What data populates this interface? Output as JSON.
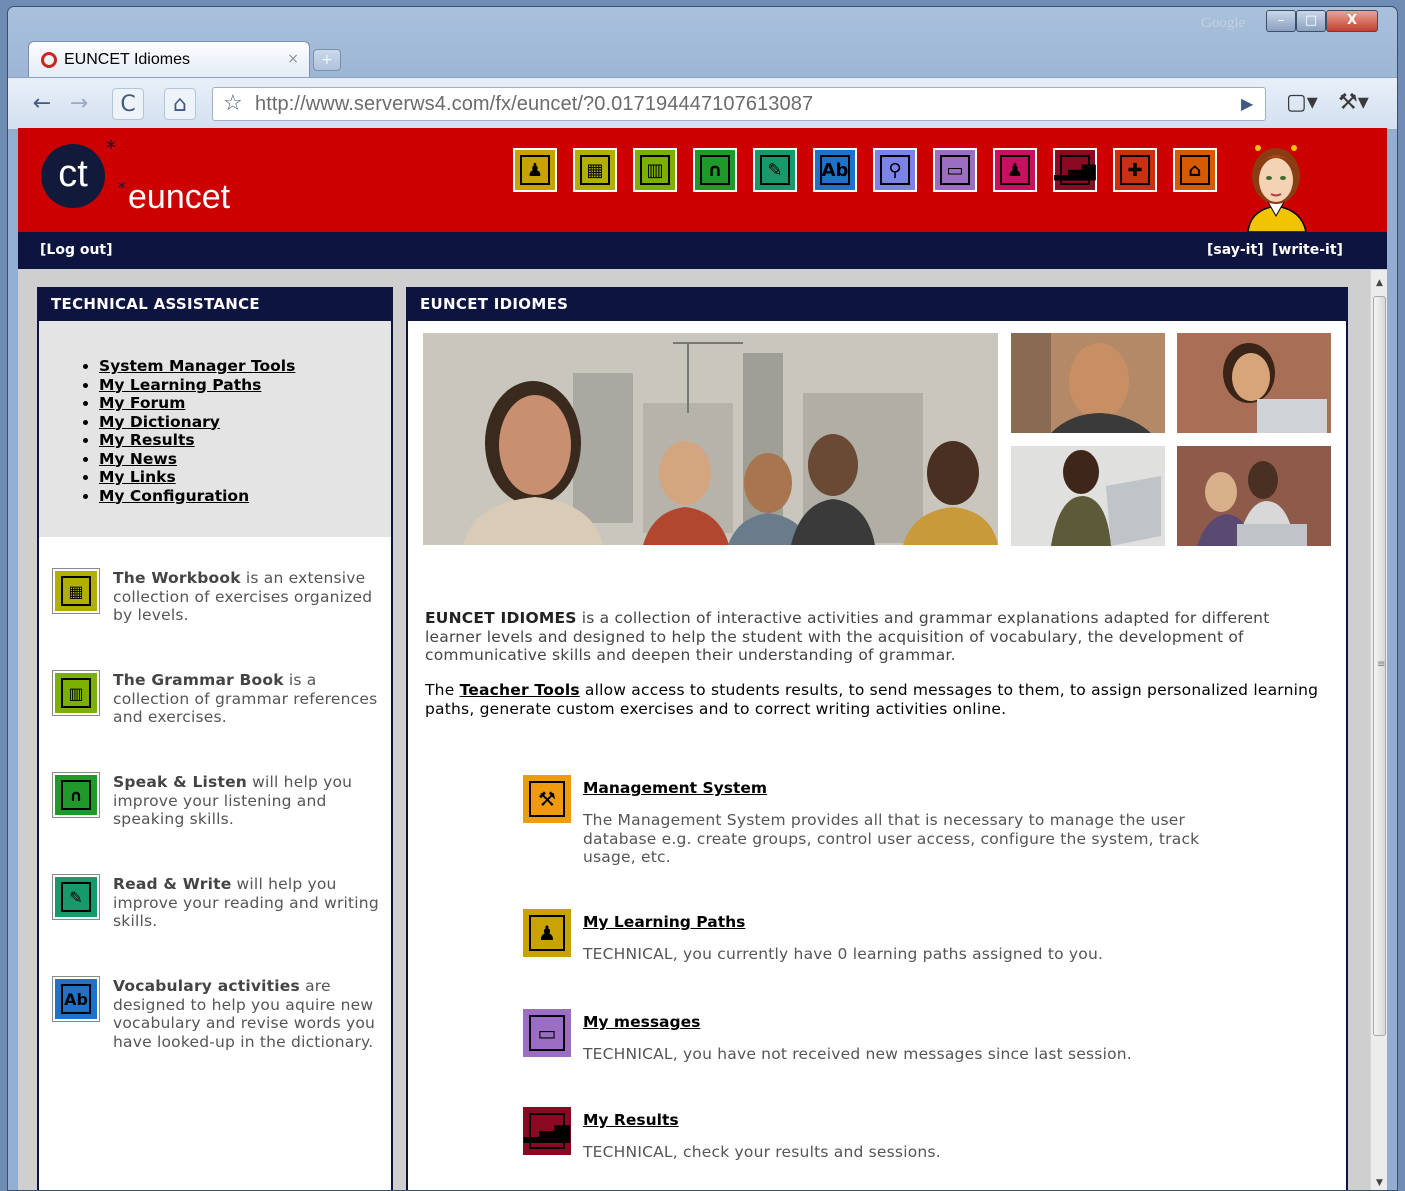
{
  "browser": {
    "tab_title": "EUNCET Idiomes",
    "tab_close": "×",
    "new_tab": "+",
    "search_brand": "Google",
    "url": "http://www.serverws4.com/fx/euncet/?0.017194447107613087",
    "window_controls": {
      "minimize": "–",
      "maximize": "□",
      "close": "X"
    }
  },
  "header": {
    "logo_initials": "ct",
    "logo_word": "euncet",
    "nav_icons": [
      {
        "name": "teacher-icon",
        "glyph": "♟",
        "bg": "#c8a200"
      },
      {
        "name": "workbook-icon",
        "glyph": "▦",
        "bg": "#b1b000"
      },
      {
        "name": "grammar-book-icon",
        "glyph": "▥",
        "bg": "#7bb000"
      },
      {
        "name": "speak-listen-icon",
        "glyph": "∩",
        "bg": "#1f9a2a"
      },
      {
        "name": "read-write-icon",
        "glyph": "✎",
        "bg": "#169a6a"
      },
      {
        "name": "vocabulary-icon",
        "glyph": "Ab",
        "bg": "#1e73c8"
      },
      {
        "name": "dictionary-search-icon",
        "glyph": "⚲",
        "bg": "#7c83e8"
      },
      {
        "name": "messages-icon",
        "glyph": "▭",
        "bg": "#9c6ec3"
      },
      {
        "name": "forum-users-icon",
        "glyph": "♟",
        "bg": "#c81060"
      },
      {
        "name": "results-icon",
        "glyph": "▂▄▆",
        "bg": "#8a0a24"
      },
      {
        "name": "first-aid-icon",
        "glyph": "✚",
        "bg": "#c83010"
      },
      {
        "name": "home-icon",
        "glyph": "⌂",
        "bg": "#d85a00"
      }
    ]
  },
  "topbar": {
    "logout": "[Log out]",
    "sayit": "[say-it]",
    "writeit": "[write-it]"
  },
  "left": {
    "title": "TECHNICAL ASSISTANCE",
    "menu": [
      "System Manager Tools",
      "My Learning Paths",
      "My Forum",
      "My Dictionary",
      "My Results",
      "My News",
      "My Links",
      "My Configuration"
    ],
    "features": [
      {
        "bold": "The Workbook",
        "rest": " is an extensive collection of exercises organized by levels.",
        "glyph": "▦",
        "bg": "#b1b000"
      },
      {
        "bold": "The Grammar Book",
        "rest": " is a collection of grammar references and exercises.",
        "glyph": "▥",
        "bg": "#7bb000"
      },
      {
        "bold": "Speak & Listen",
        "rest": " will help you improve your listening and speaking skills.",
        "glyph": "∩",
        "bg": "#1f9a2a"
      },
      {
        "bold": "Read & Write",
        "rest": " will help you improve your reading and writing skills.",
        "glyph": "✎",
        "bg": "#169a6a"
      },
      {
        "bold": "Vocabulary activities",
        "rest": " are designed to help you aquire new vocabulary and revise words you have looked-up in the dictionary.",
        "glyph": "Ab",
        "bg": "#1e73c8"
      }
    ]
  },
  "main": {
    "title": "EUNCET IDIOMES",
    "intro_bold": "EUNCET IDIOMES",
    "intro_rest": " is a collection of interactive activities and grammar explanations adapted for different learner levels and designed to help the student with the acquisition of vocabulary, the development of communicative skills and deepen their understanding of grammar.",
    "teacher_pre": "The ",
    "teacher_link": "Teacher Tools",
    "teacher_post": " allow access to students results, to send messages to them, to assign personalized learning paths, generate custom exercises and to correct writing activities online.",
    "services": [
      {
        "title": "Management System",
        "desc": "The Management System provides all that is necessary to manage the user database e.g. create groups, control user access, configure the system, track usage, etc.",
        "glyph": "⚒",
        "bg": "#f09a10"
      },
      {
        "title": "My Learning Paths",
        "desc": "TECHNICAL, you currently have 0 learning paths assigned to you.",
        "glyph": "♟",
        "bg": "#c8a200"
      },
      {
        "title": "My messages",
        "desc": "TECHNICAL, you have not received new messages since last session.",
        "glyph": "▭",
        "bg": "#9c6ec3"
      },
      {
        "title": "My Results",
        "desc": "TECHNICAL, check your results and sessions.",
        "glyph": "▂▄▆",
        "bg": "#8a0a24"
      }
    ]
  }
}
